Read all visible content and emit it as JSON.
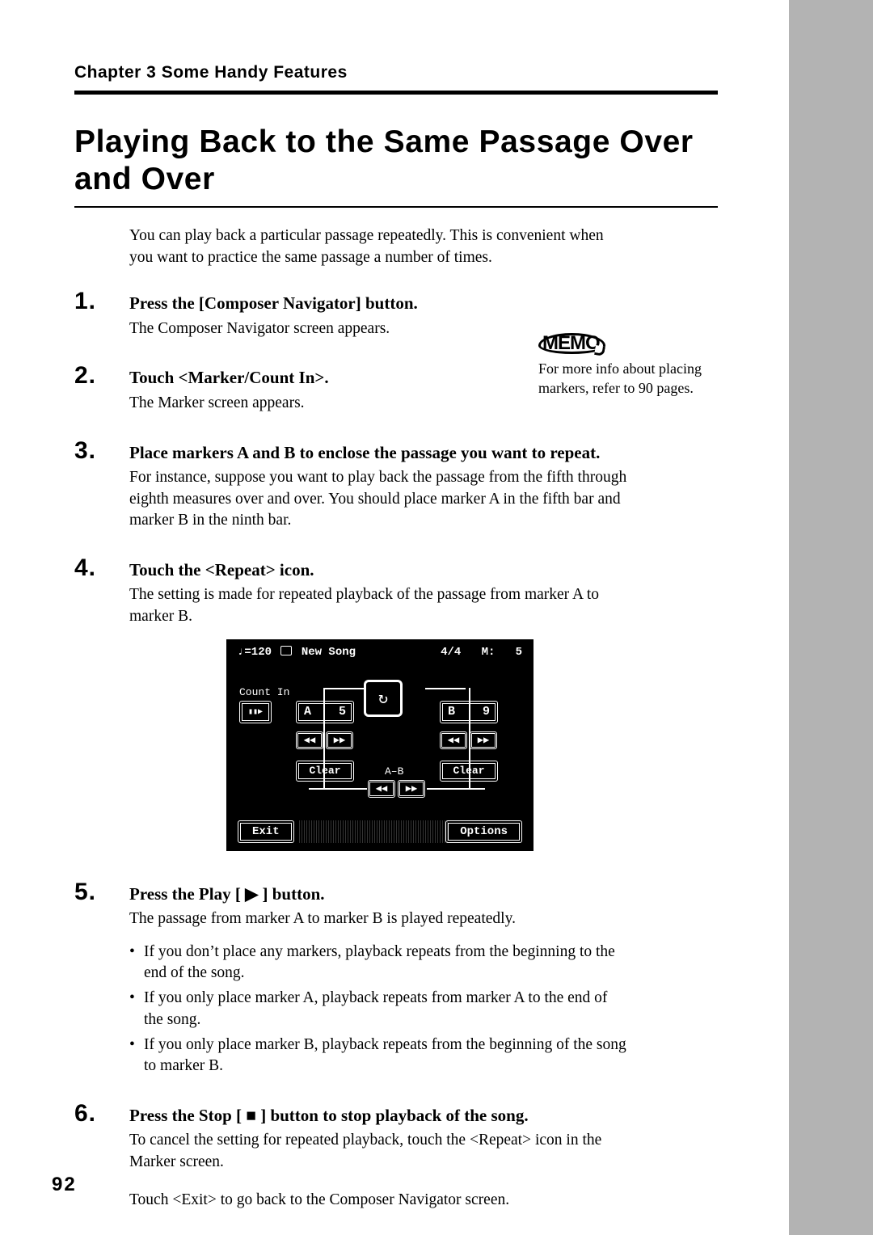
{
  "chapter": "Chapter 3 Some Handy Features",
  "title": "Playing Back to the Same Passage Over and Over",
  "intro": "You can play back a particular passage repeatedly. This is convenient when you want to practice the same passage a number of times.",
  "steps": [
    {
      "num": "1.",
      "head": "Press the [Composer Navigator] button.",
      "text": "The Composer Navigator screen appears."
    },
    {
      "num": "2.",
      "head": "Touch <Marker/Count In>.",
      "text": "The Marker screen appears."
    },
    {
      "num": "3.",
      "head": "Place markers A and B to enclose the passage you want to repeat.",
      "text": "For instance, suppose you want to play back the passage from the fifth through eighth measures over and over. You should place marker A in the fifth bar and marker B in the ninth bar."
    },
    {
      "num": "4.",
      "head": "Touch the <Repeat> icon.",
      "text": "The setting is made for repeated playback of the passage from marker A to marker B."
    },
    {
      "num": "5.",
      "head": "Press the Play [ ▶ ] button.",
      "text": "The passage from marker A to marker B is played repeatedly.",
      "bullets": [
        "If you don’t place any markers, playback repeats from the beginning to the end of the song.",
        "If you only place marker A, playback repeats from marker A to the end of the song.",
        "If you only place marker B, playback repeats from the beginning of the song to marker B."
      ]
    },
    {
      "num": "6.",
      "head": "Press the Stop [ ■ ] button to stop playback of the song.",
      "text": "To cancel the setting for repeated playback, touch the <Repeat> icon in the Marker screen.",
      "text2": "Touch <Exit> to go back to the Composer Navigator screen."
    }
  ],
  "memo": {
    "label": "MEMO",
    "text": "For more info about placing markers, refer to 90 pages."
  },
  "screenshot": {
    "tempo": "♩=120",
    "song": "New Song",
    "timesig": "4/4",
    "measure_label": "M:",
    "measure": "5",
    "countin_label": "Count In",
    "markerA": {
      "label": "A",
      "val": "5"
    },
    "markerB": {
      "label": "B",
      "val": "9"
    },
    "clear": "Clear",
    "ab": "A–B",
    "exit": "Exit",
    "options": "Options",
    "repeat": "↻",
    "prev": "◀◀",
    "next": "▶▶",
    "countin_icon": "▮▮▶"
  },
  "page_number": "92"
}
